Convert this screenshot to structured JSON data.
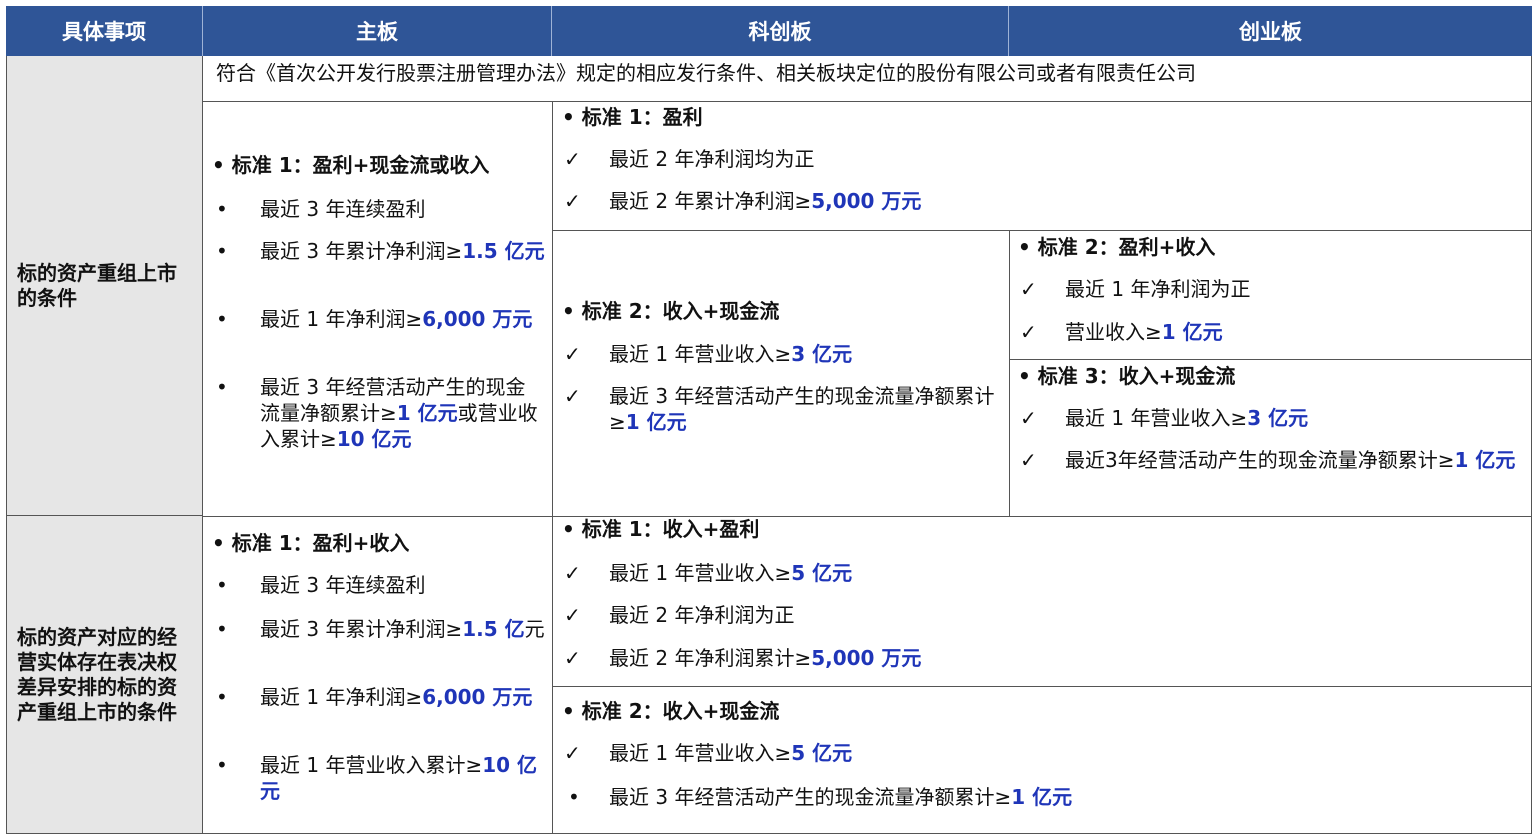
{
  "headers": {
    "col1": "具体事项",
    "col2": "主板",
    "col3": "科创板",
    "col4": "创业板"
  },
  "row1": {
    "label": "标的资产重组上市的条件",
    "banner": "符合《首次公开发行股票注册管理办法》规定的相应发行条件、相关板块定位的股份有限公司或者有限责任公司",
    "main": {
      "title": "• 标准 1：盈利+现金流或收入",
      "items": [
        [
          "最近 3 年连续盈利",
          ""
        ],
        [
          "最近 3 年累计净利润≥",
          "1.5 亿元"
        ],
        [
          "最近 1 年净利润≥",
          "6,000 万元"
        ],
        [
          "最近 3 年经营活动产生的现金流量净额累计≥",
          "1 亿元",
          "或营业收入累计≥",
          "10 亿元"
        ]
      ]
    },
    "shared_std1": {
      "title": "• 标准 1：盈利",
      "items": [
        [
          "最近 2 年净利润均为正",
          ""
        ],
        [
          "最近 2 年累计净利润≥",
          "5,000 万元"
        ]
      ]
    },
    "star_std2": {
      "title": "• 标准 2：收入+现金流",
      "items": [
        [
          "最近 1 年营业收入≥",
          "3 亿元"
        ],
        [
          "最近 3 年经营活动产生的现金流量净额累计≥",
          "1 亿元"
        ]
      ]
    },
    "gem_std2": {
      "title": "• 标准 2：盈利+收入",
      "items": [
        [
          "最近 1 年净利润为正",
          ""
        ],
        [
          "营业收入≥",
          "1 亿元"
        ]
      ]
    },
    "gem_std3": {
      "title": "• 标准 3：收入+现金流",
      "items": [
        [
          "最近 1 年营业收入≥",
          "3 亿元"
        ],
        [
          "最近3年经营活动产生的现金流量净额累计≥",
          "1 亿元"
        ]
      ]
    }
  },
  "row2": {
    "label": "标的资产对应的经营实体存在表决权差异安排的标的资产重组上市的条件",
    "main": {
      "title": "• 标准 1：盈利+收入",
      "items": [
        [
          "最近 3 年连续盈利",
          ""
        ],
        [
          "最近 3 年累计净利润≥",
          "1.5 亿",
          "元"
        ],
        [
          "最近 1 年净利润≥",
          "6,000 万元"
        ],
        [
          "最近 1 年营业收入累计≥",
          "10 亿元"
        ]
      ]
    },
    "std1": {
      "title": "• 标准 1：收入+盈利",
      "items": [
        [
          "最近 1 年营业收入≥",
          "5 亿元"
        ],
        [
          "最近 2 年净利润为正",
          ""
        ],
        [
          "最近 2 年净利润累计≥",
          "5,000 万元"
        ]
      ]
    },
    "std2": {
      "title": "• 标准 2：收入+现金流",
      "items": [
        [
          "最近 1 年营业收入≥",
          "5 亿元"
        ],
        [
          "最近 3 年经营活动产生的现金流量净额累计≥",
          "1 亿元"
        ]
      ]
    }
  },
  "symbols": {
    "bullet": "•",
    "check": "✓"
  },
  "colors": {
    "header_bg": "#2f5597",
    "emphasis": "#1f35b8",
    "label_bg": "#e6e6e6"
  }
}
